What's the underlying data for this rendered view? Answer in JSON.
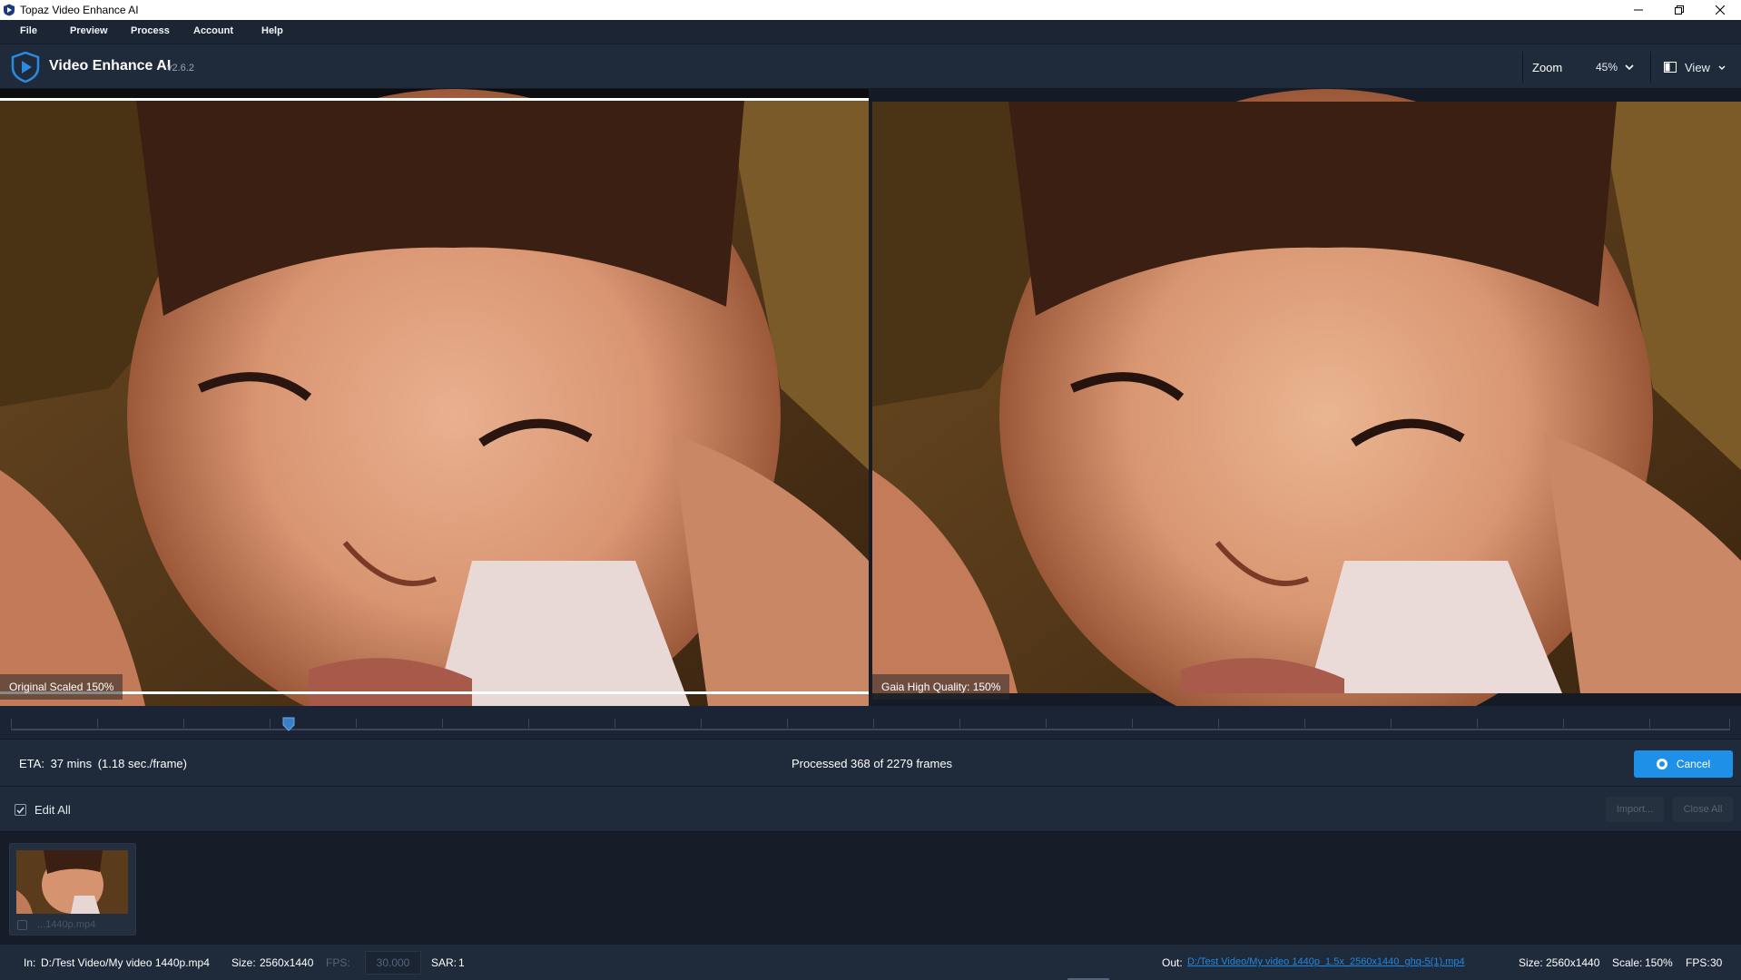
{
  "window": {
    "title": "Topaz Video Enhance AI"
  },
  "menu": {
    "items": [
      "File",
      "Preview",
      "Process",
      "Account",
      "Help"
    ]
  },
  "header": {
    "app_name": "Video Enhance AI",
    "version": "v2.6.2",
    "zoom_label": "Zoom",
    "zoom_value": "45%",
    "view_label": "View"
  },
  "preview": {
    "left_caption": "Original Scaled 150%",
    "right_caption": "Gaia High Quality: 150%"
  },
  "status": {
    "eta_label": "ETA:",
    "eta_value": "37 mins",
    "eta_rate": "(1.18 sec./frame)",
    "processed": "Processed 368 of 2279 frames",
    "processed_current": 368,
    "processed_total": 2279,
    "cancel_label": "Cancel"
  },
  "edit": {
    "edit_all_label": "Edit All",
    "edit_all_checked": true,
    "import_label": "Import...",
    "close_all_label": "Close All"
  },
  "queue": {
    "items": [
      {
        "name": "...1440p.mp4",
        "checked": true
      }
    ]
  },
  "info": {
    "in_label": "In:",
    "in_path": "D:/Test Video/My video 1440p.mp4",
    "size_label": "Size:",
    "in_size": "2560x1440",
    "fps_label": "FPS:",
    "fps_value": "30.000",
    "sar_label": "SAR:",
    "sar_value": "1",
    "out_label": "Out:",
    "out_path": "D:/Test Video/My video 1440p_1.5x_2560x1440_ghq-5(1).mp4",
    "out_size": "2560x1440",
    "scale_label": "Scale:",
    "scale_value": "150%",
    "out_fps_label": "FPS:",
    "out_fps_value": "30"
  },
  "colors": {
    "accent": "#1e90e8",
    "link": "#1e88e5",
    "panel": "#1f2a3b",
    "background": "#1b2332"
  }
}
